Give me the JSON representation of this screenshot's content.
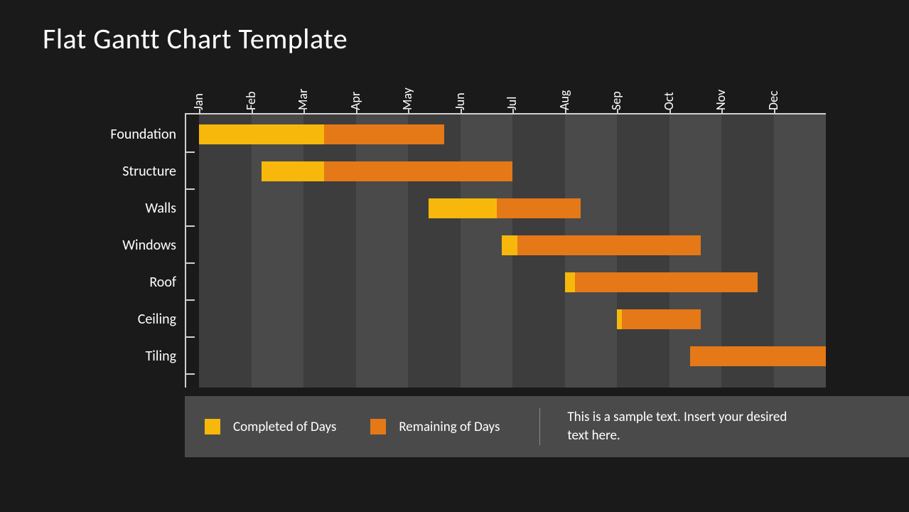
{
  "title": "Flat Gantt Chart Template",
  "legend": {
    "completed": "Completed of Days",
    "remaining": "Remaining of Days",
    "note": "This is a sample text. Insert your desired text here."
  },
  "chart_data": {
    "type": "bar",
    "subtype": "gantt",
    "title": "Flat Gantt Chart Template",
    "xlabel": "",
    "ylabel": "",
    "categories": [
      "Jan",
      "Feb",
      "Mar",
      "Apr",
      "May",
      "Jun",
      "Jul",
      "Aug",
      "Sep",
      "Oct",
      "Nov",
      "Dec"
    ],
    "months": [
      "Jan",
      "Feb",
      "Mar",
      "Apr",
      "May",
      "Jun",
      "Jul",
      "Aug",
      "Sep",
      "Oct",
      "Nov",
      "Dec"
    ],
    "xlim": [
      0,
      12
    ],
    "tasks": [
      {
        "name": "Foundation",
        "start": 0.0,
        "end": 4.7,
        "completed_until": 2.4
      },
      {
        "name": "Structure",
        "start": 1.2,
        "end": 6.0,
        "completed_until": 2.4
      },
      {
        "name": "Walls",
        "start": 4.4,
        "end": 7.3,
        "completed_until": 5.7
      },
      {
        "name": "Windows",
        "start": 5.8,
        "end": 9.6,
        "completed_until": 6.1
      },
      {
        "name": "Roof",
        "start": 7.0,
        "end": 10.7,
        "completed_until": 7.2
      },
      {
        "name": "Ceiling",
        "start": 8.0,
        "end": 9.6,
        "completed_until": 8.1
      },
      {
        "name": "Tiling",
        "start": 9.4,
        "end": 12.0,
        "completed_until": 9.4
      }
    ],
    "legend": [
      "Completed of Days",
      "Remaining of Days"
    ],
    "colors": {
      "completed": "#f7b80b",
      "remaining": "#e57817"
    },
    "grid": {
      "vertical_stripes": true
    }
  }
}
